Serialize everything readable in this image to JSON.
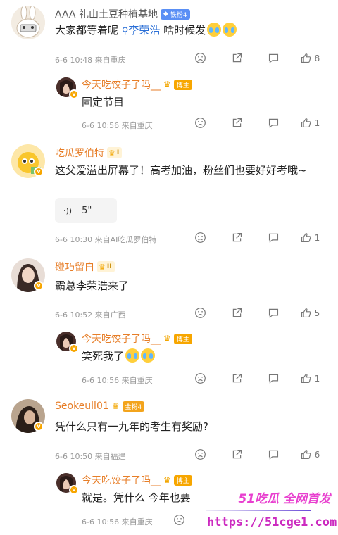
{
  "comments": [
    {
      "user": "AAA 礼山土豆种植基地",
      "badge": "铁粉4",
      "text_before": "大家都等着呢",
      "link": "李荣浩",
      "text_after": "啥时候发",
      "meta": "6-6 10:48  来自重庆",
      "likes": "8",
      "reply": {
        "user": "今天吃饺子了吗__",
        "badge": "博主",
        "text": "固定节目",
        "meta": "6-6 10:56  来自重庆",
        "likes": "1"
      }
    },
    {
      "user": "吃瓜罗伯特",
      "rank": "I",
      "text": "这父爱溢出屏幕了！高考加油，粉丝们也要好好考哦~",
      "voice": "5\"",
      "meta": "6-6 10:30  来自AI吃瓜罗伯特",
      "likes": "1"
    },
    {
      "user": "碰巧留白",
      "rank": "II",
      "text": "霸总李荣浩来了",
      "meta": "6-6 10:52  来自广西",
      "likes": "5",
      "reply": {
        "user": "今天吃饺子了吗__",
        "badge": "博主",
        "text": "笑死我了",
        "meta": "6-6 10:56  来自重庆",
        "likes": "1"
      }
    },
    {
      "user": "Seokeull01",
      "badge": "金粉4",
      "text": "凭什么只有一九年的考生有奖励?",
      "meta": "6-6 10:50  来自福建",
      "likes": "6",
      "reply": {
        "user": "今天吃饺子了吗__",
        "badge": "博主",
        "text": "就是。凭什么 今年也要",
        "meta": "6-6 10:56  来自重庆",
        "likes": ""
      }
    }
  ],
  "watermark": {
    "brand": "51吃瓜 全网首发",
    "url": "https://51cge1.com"
  },
  "colors": {
    "username": "#e77e28",
    "link": "#2b6fd6",
    "meta": "#999999",
    "author_badge": "#f7a600",
    "watermark": "#e83fcf"
  }
}
